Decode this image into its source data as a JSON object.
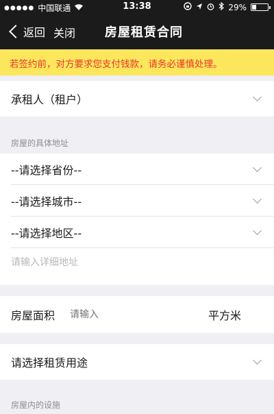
{
  "status_bar": {
    "carrier": "中国联通",
    "time": "13:38",
    "battery": "29%",
    "battery_level": 0.29
  },
  "nav": {
    "back_label": "返回",
    "close_label": "关闭",
    "title": "房屋租赁合同"
  },
  "warning": {
    "text": "若签约前，对方要求您支付钱款，请务必谨慎处理。"
  },
  "tenant": {
    "label": "承租人（租户）"
  },
  "address": {
    "header": "房屋的具体地址",
    "province": "--请选择省份--",
    "city": "--请选择城市--",
    "district": "--请选择地区--",
    "detail_placeholder": "请输入详细地址"
  },
  "area": {
    "label": "房屋面积",
    "placeholder": "请输入",
    "unit": "平方米"
  },
  "usage": {
    "label": "请选择租赁用途"
  },
  "facilities": {
    "header": "房屋内的设施"
  },
  "colors": {
    "warning_bg": "#fce75c",
    "warning_text": "#e8342b",
    "nav_bg": "#1b1b1b"
  }
}
